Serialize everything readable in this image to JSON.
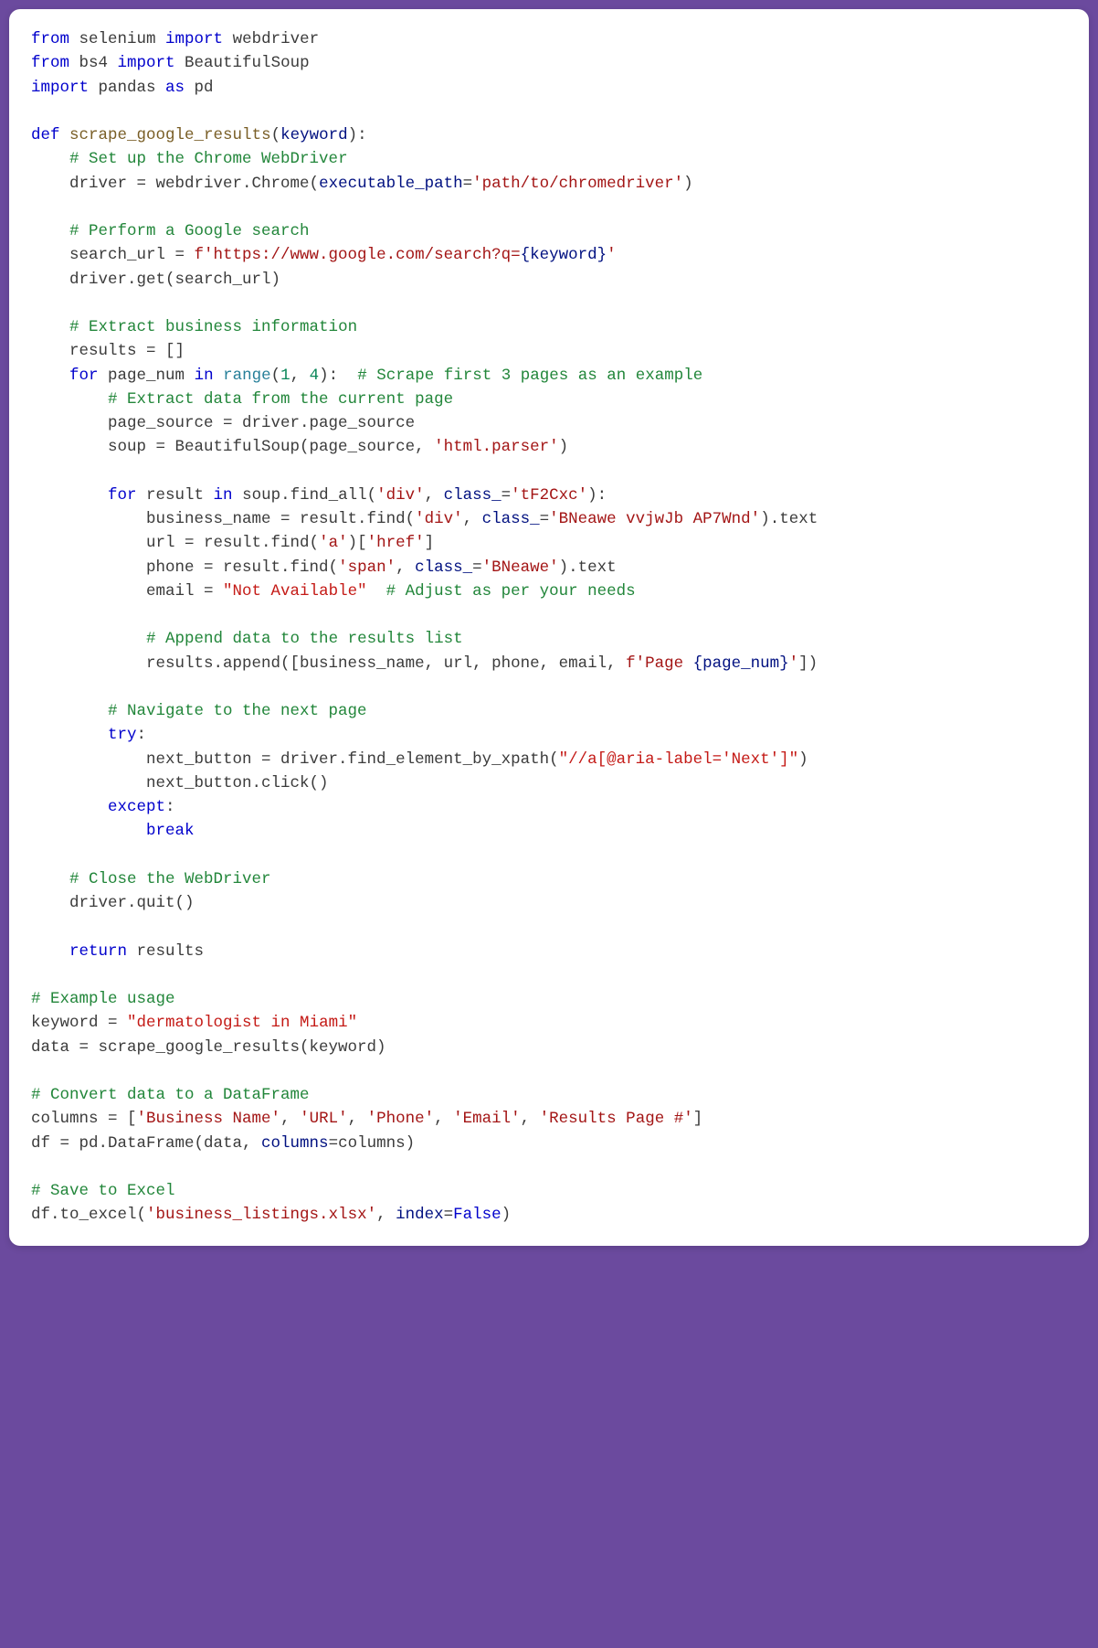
{
  "code": {
    "lines": [
      [
        {
          "t": "from",
          "c": "kw"
        },
        {
          "t": " selenium ",
          "c": "txt"
        },
        {
          "t": "import",
          "c": "kw"
        },
        {
          "t": " webdriver",
          "c": "txt"
        }
      ],
      [
        {
          "t": "from",
          "c": "kw"
        },
        {
          "t": " bs4 ",
          "c": "txt"
        },
        {
          "t": "import",
          "c": "kw"
        },
        {
          "t": " BeautifulSoup",
          "c": "txt"
        }
      ],
      [
        {
          "t": "import",
          "c": "kw"
        },
        {
          "t": " pandas ",
          "c": "txt"
        },
        {
          "t": "as",
          "c": "kw"
        },
        {
          "t": " pd",
          "c": "txt"
        }
      ],
      [],
      [
        {
          "t": "def",
          "c": "kw"
        },
        {
          "t": " ",
          "c": "txt"
        },
        {
          "t": "scrape_google_results",
          "c": "fn"
        },
        {
          "t": "(",
          "c": "txt"
        },
        {
          "t": "keyword",
          "c": "param"
        },
        {
          "t": "):",
          "c": "txt"
        }
      ],
      [
        {
          "t": "    ",
          "c": "txt"
        },
        {
          "t": "# Set up the Chrome WebDriver",
          "c": "com"
        }
      ],
      [
        {
          "t": "    driver = webdriver.Chrome(",
          "c": "txt"
        },
        {
          "t": "executable_path",
          "c": "param"
        },
        {
          "t": "=",
          "c": "txt"
        },
        {
          "t": "'path/to/chromedriver'",
          "c": "str"
        },
        {
          "t": ")",
          "c": "txt"
        }
      ],
      [],
      [
        {
          "t": "    ",
          "c": "txt"
        },
        {
          "t": "# Perform a Google search",
          "c": "com"
        }
      ],
      [
        {
          "t": "    search_url = ",
          "c": "txt"
        },
        {
          "t": "f'https://www.google.com/search?q=",
          "c": "str"
        },
        {
          "t": "{keyword}",
          "c": "param"
        },
        {
          "t": "'",
          "c": "str"
        }
      ],
      [
        {
          "t": "    driver.get(search_url)",
          "c": "txt"
        }
      ],
      [],
      [
        {
          "t": "    ",
          "c": "txt"
        },
        {
          "t": "# Extract business information",
          "c": "com"
        }
      ],
      [
        {
          "t": "    results = []",
          "c": "txt"
        }
      ],
      [
        {
          "t": "    ",
          "c": "txt"
        },
        {
          "t": "for",
          "c": "kw"
        },
        {
          "t": " page_num ",
          "c": "txt"
        },
        {
          "t": "in",
          "c": "kw"
        },
        {
          "t": " ",
          "c": "txt"
        },
        {
          "t": "range",
          "c": "builtin"
        },
        {
          "t": "(",
          "c": "txt"
        },
        {
          "t": "1",
          "c": "num"
        },
        {
          "t": ", ",
          "c": "txt"
        },
        {
          "t": "4",
          "c": "num"
        },
        {
          "t": "):  ",
          "c": "txt"
        },
        {
          "t": "# Scrape first 3 pages as an example",
          "c": "com"
        }
      ],
      [
        {
          "t": "        ",
          "c": "txt"
        },
        {
          "t": "# Extract data from the current page",
          "c": "com"
        }
      ],
      [
        {
          "t": "        page_source = driver.page_source",
          "c": "txt"
        }
      ],
      [
        {
          "t": "        soup = BeautifulSoup(page_source, ",
          "c": "txt"
        },
        {
          "t": "'html.parser'",
          "c": "str"
        },
        {
          "t": ")",
          "c": "txt"
        }
      ],
      [],
      [
        {
          "t": "        ",
          "c": "txt"
        },
        {
          "t": "for",
          "c": "kw"
        },
        {
          "t": " result ",
          "c": "txt"
        },
        {
          "t": "in",
          "c": "kw"
        },
        {
          "t": " soup.find_all(",
          "c": "txt"
        },
        {
          "t": "'div'",
          "c": "str"
        },
        {
          "t": ", ",
          "c": "txt"
        },
        {
          "t": "class_",
          "c": "param"
        },
        {
          "t": "=",
          "c": "txt"
        },
        {
          "t": "'tF2Cxc'",
          "c": "str"
        },
        {
          "t": "):",
          "c": "txt"
        }
      ],
      [
        {
          "t": "            business_name = result.find(",
          "c": "txt"
        },
        {
          "t": "'div'",
          "c": "str"
        },
        {
          "t": ", ",
          "c": "txt"
        },
        {
          "t": "class_",
          "c": "param"
        },
        {
          "t": "=",
          "c": "txt"
        },
        {
          "t": "'BNeawe vvjwJb AP7Wnd'",
          "c": "str"
        },
        {
          "t": ").text",
          "c": "txt"
        }
      ],
      [
        {
          "t": "            url = result.find(",
          "c": "txt"
        },
        {
          "t": "'a'",
          "c": "str"
        },
        {
          "t": ")[",
          "c": "txt"
        },
        {
          "t": "'href'",
          "c": "str"
        },
        {
          "t": "]",
          "c": "txt"
        }
      ],
      [
        {
          "t": "            phone = result.find(",
          "c": "txt"
        },
        {
          "t": "'span'",
          "c": "str"
        },
        {
          "t": ", ",
          "c": "txt"
        },
        {
          "t": "class_",
          "c": "param"
        },
        {
          "t": "=",
          "c": "txt"
        },
        {
          "t": "'BNeawe'",
          "c": "str"
        },
        {
          "t": ").text",
          "c": "txt"
        }
      ],
      [
        {
          "t": "            email = ",
          "c": "txt"
        },
        {
          "t": "\"Not Available\"",
          "c": "str2"
        },
        {
          "t": "  ",
          "c": "txt"
        },
        {
          "t": "# Adjust as per your needs",
          "c": "com"
        }
      ],
      [],
      [
        {
          "t": "            ",
          "c": "txt"
        },
        {
          "t": "# Append data to the results list",
          "c": "com"
        }
      ],
      [
        {
          "t": "            results.append([business_name, url, phone, email, ",
          "c": "txt"
        },
        {
          "t": "f'Page ",
          "c": "str"
        },
        {
          "t": "{page_num}",
          "c": "param"
        },
        {
          "t": "'",
          "c": "str"
        },
        {
          "t": "])",
          "c": "txt"
        }
      ],
      [],
      [
        {
          "t": "        ",
          "c": "txt"
        },
        {
          "t": "# Navigate to the next page",
          "c": "com"
        }
      ],
      [
        {
          "t": "        ",
          "c": "txt"
        },
        {
          "t": "try",
          "c": "kw"
        },
        {
          "t": ":",
          "c": "txt"
        }
      ],
      [
        {
          "t": "            next_button = driver.find_element_by_xpath(",
          "c": "txt"
        },
        {
          "t": "\"//a[@aria-label='Next']\"",
          "c": "str2"
        },
        {
          "t": ")",
          "c": "txt"
        }
      ],
      [
        {
          "t": "            next_button.click()",
          "c": "txt"
        }
      ],
      [
        {
          "t": "        ",
          "c": "txt"
        },
        {
          "t": "except",
          "c": "kw"
        },
        {
          "t": ":",
          "c": "txt"
        }
      ],
      [
        {
          "t": "            ",
          "c": "txt"
        },
        {
          "t": "break",
          "c": "kw"
        }
      ],
      [],
      [
        {
          "t": "    ",
          "c": "txt"
        },
        {
          "t": "# Close the WebDriver",
          "c": "com"
        }
      ],
      [
        {
          "t": "    driver.quit()",
          "c": "txt"
        }
      ],
      [],
      [
        {
          "t": "    ",
          "c": "txt"
        },
        {
          "t": "return",
          "c": "kw"
        },
        {
          "t": " results",
          "c": "txt"
        }
      ],
      [],
      [
        {
          "t": "# Example usage",
          "c": "com"
        }
      ],
      [
        {
          "t": "keyword = ",
          "c": "txt"
        },
        {
          "t": "\"dermatologist in Miami\"",
          "c": "str2"
        }
      ],
      [
        {
          "t": "data = scrape_google_results(keyword)",
          "c": "txt"
        }
      ],
      [],
      [
        {
          "t": "# Convert data to a DataFrame",
          "c": "com"
        }
      ],
      [
        {
          "t": "columns = [",
          "c": "txt"
        },
        {
          "t": "'Business Name'",
          "c": "str"
        },
        {
          "t": ", ",
          "c": "txt"
        },
        {
          "t": "'URL'",
          "c": "str"
        },
        {
          "t": ", ",
          "c": "txt"
        },
        {
          "t": "'Phone'",
          "c": "str"
        },
        {
          "t": ", ",
          "c": "txt"
        },
        {
          "t": "'Email'",
          "c": "str"
        },
        {
          "t": ", ",
          "c": "txt"
        },
        {
          "t": "'Results Page #'",
          "c": "str"
        },
        {
          "t": "]",
          "c": "txt"
        }
      ],
      [
        {
          "t": "df = pd.DataFrame(data, ",
          "c": "txt"
        },
        {
          "t": "columns",
          "c": "param"
        },
        {
          "t": "=columns)",
          "c": "txt"
        }
      ],
      [],
      [
        {
          "t": "# Save to Excel",
          "c": "com"
        }
      ],
      [
        {
          "t": "df.to_excel(",
          "c": "txt"
        },
        {
          "t": "'business_listings.xlsx'",
          "c": "str"
        },
        {
          "t": ", ",
          "c": "txt"
        },
        {
          "t": "index",
          "c": "param"
        },
        {
          "t": "=",
          "c": "txt"
        },
        {
          "t": "False",
          "c": "const"
        },
        {
          "t": ")",
          "c": "txt"
        }
      ]
    ]
  }
}
